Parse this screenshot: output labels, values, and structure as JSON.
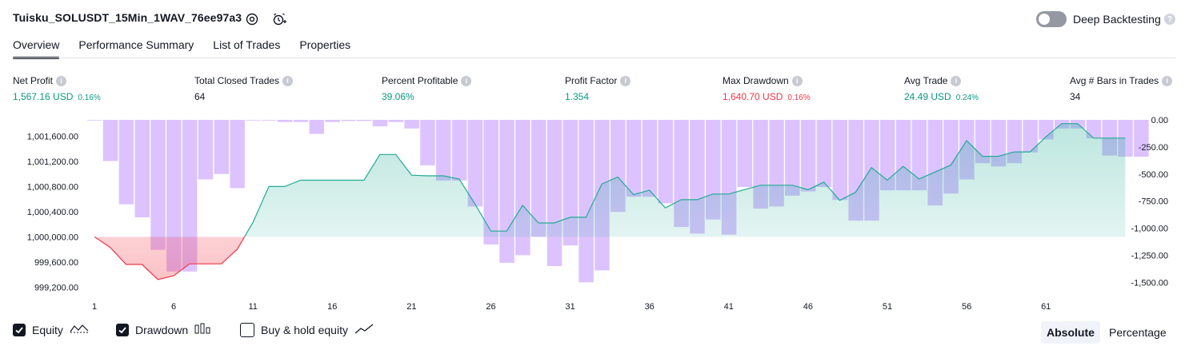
{
  "header": {
    "title": "Tuisku_SOLUSDT_15Min_1WAV_76ee97a3",
    "deep_backtesting_label": "Deep Backtesting",
    "deep_backtesting_on": false,
    "help_glyph": "?"
  },
  "tabs": [
    {
      "label": "Overview",
      "active": true
    },
    {
      "label": "Performance Summary",
      "active": false
    },
    {
      "label": "List of Trades",
      "active": false
    },
    {
      "label": "Properties",
      "active": false
    }
  ],
  "metrics": [
    {
      "label": "Net Profit",
      "value": "1,567.16 USD",
      "pct": "0.16%",
      "color": "#089981"
    },
    {
      "label": "Total Closed Trades",
      "value": "64",
      "pct": "",
      "color": "#131722"
    },
    {
      "label": "Percent Profitable",
      "value": "39.06%",
      "pct": "",
      "color": "#089981"
    },
    {
      "label": "Profit Factor",
      "value": "1.354",
      "pct": "",
      "color": "#089981"
    },
    {
      "label": "Max Drawdown",
      "value": "1,640.70 USD",
      "pct": "0.16%",
      "color": "#f23645"
    },
    {
      "label": "Avg Trade",
      "value": "24.49 USD",
      "pct": "0.24%",
      "color": "#089981"
    },
    {
      "label": "Avg # Bars in Trades",
      "value": "34",
      "pct": "",
      "color": "#131722"
    }
  ],
  "chart_data": {
    "type": "area",
    "x_ticks": [
      "1",
      "6",
      "11",
      "16",
      "21",
      "26",
      "31",
      "36",
      "41",
      "46",
      "51",
      "56",
      "61"
    ],
    "left_axis": {
      "ticks": [
        "1,001,600.00",
        "1,001,200.00",
        "1,000,800.00",
        "1,000,400.00",
        "1,000,000.00",
        "999,600.00",
        "999,200.00"
      ],
      "tick_values": [
        1001600,
        1001200,
        1000800,
        1000400,
        1000000,
        999600,
        999200
      ],
      "range": [
        999000,
        1001860
      ],
      "baseline": 1000000
    },
    "right_axis": {
      "ticks": [
        "0.00",
        "-250.00",
        "-500.00",
        "-750.00",
        "-1,000.00",
        "-1,250.00",
        "-1,500.00"
      ],
      "tick_values": [
        0,
        -250,
        -500,
        -750,
        -1000,
        -1250,
        -1500
      ],
      "range": [
        -1660,
        0
      ]
    },
    "series": [
      {
        "name": "Equity",
        "color_positive": "#22ab94",
        "color_negative": "#f23645",
        "values": [
          1000000,
          999830,
          999560,
          999560,
          999320,
          999380,
          999570,
          999570,
          999570,
          999800,
          1000230,
          1000800,
          1000800,
          1000900,
          1000900,
          1000900,
          1000900,
          1000900,
          1001310,
          1001310,
          1000980,
          1000970,
          1000970,
          1000920,
          1000520,
          1000090,
          1000090,
          1000500,
          1000220,
          1000220,
          1000310,
          1000310,
          1000840,
          1000950,
          1000670,
          1000740,
          1000460,
          1000590,
          1000590,
          1000680,
          1000680,
          1000750,
          1000820,
          1000820,
          1000820,
          1000750,
          1000870,
          1000580,
          1000710,
          1001100,
          1000900,
          1001120,
          1000920,
          1001030,
          1001140,
          1001530,
          1001280,
          1001280,
          1001350,
          1001350,
          1001590,
          1001800,
          1001800,
          1001570,
          1001570,
          1001570
        ]
      },
      {
        "name": "Drawdown",
        "color": "#c49bff",
        "values": [
          0,
          -380,
          -780,
          -900,
          -1200,
          -1400,
          -1400,
          -550,
          -500,
          -630,
          0,
          0,
          -20,
          -20,
          -130,
          -20,
          -10,
          -10,
          -60,
          -20,
          -80,
          -420,
          -560,
          -560,
          -800,
          -1150,
          -1320,
          -1250,
          -1080,
          -1350,
          -1160,
          -1500,
          -1390,
          -850,
          -710,
          -710,
          -770,
          -990,
          -1050,
          -920,
          -1060,
          -620,
          -820,
          -800,
          -700,
          -660,
          -620,
          -740,
          -930,
          -930,
          -650,
          -650,
          -650,
          -790,
          -680,
          -550,
          -400,
          -430,
          -400,
          -300,
          -180,
          -80,
          -80,
          -170,
          -330,
          -340,
          -340
        ]
      },
      {
        "name": "Buy & hold equity",
        "color": "#131722",
        "values": []
      }
    ]
  },
  "legend": {
    "equity_label": "Equity",
    "drawdown_label": "Drawdown",
    "buyhold_label": "Buy & hold equity",
    "equity_checked": true,
    "drawdown_checked": true,
    "buyhold_checked": false
  },
  "mode": {
    "absolute_label": "Absolute",
    "percentage_label": "Percentage",
    "selected": "Absolute"
  }
}
